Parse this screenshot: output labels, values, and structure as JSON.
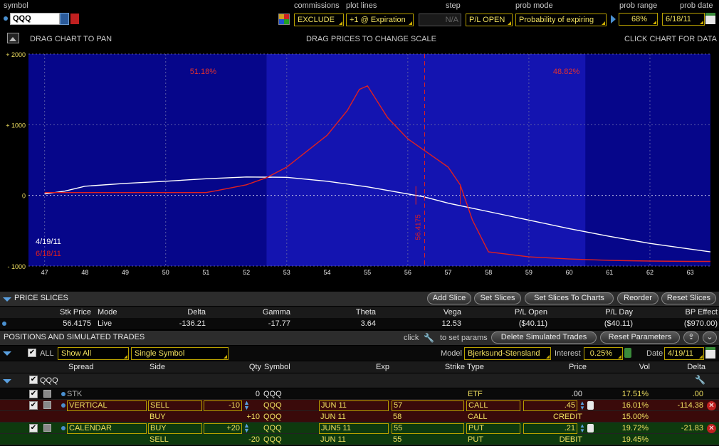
{
  "header": {
    "symbol_label": "symbol",
    "symbol_value": "QQQ",
    "commissions_label": "commissions",
    "commissions_value": "EXCLUDE",
    "plot_lines_label": "plot lines",
    "plot_lines_value": "+1 @ Expiration",
    "step_label": "step",
    "step_value": "N/A",
    "step_mode": "P/L OPEN",
    "prob_mode_label": "prob mode",
    "prob_mode_value": "Probability of expiring",
    "prob_range_label": "prob range",
    "prob_range_value": "68%",
    "prob_date_label": "prob date",
    "prob_date_value": "6/18/11"
  },
  "chart_hints": {
    "pan": "DRAG CHART TO PAN",
    "scale": "DRAG PRICES TO CHANGE SCALE",
    "click": "CLICK CHART FOR DATA"
  },
  "chart_data": {
    "type": "line",
    "x_ticks": [
      "47",
      "48",
      "49",
      "50",
      "51",
      "52",
      "53",
      "54",
      "55",
      "56",
      "57",
      "58",
      "59",
      "60",
      "61",
      "62",
      "63"
    ],
    "y_ticks": [
      "+ 2000",
      "+ 1000",
      "0",
      "- 1000"
    ],
    "xlim": [
      46.6,
      63.5
    ],
    "ylim": [
      -1000,
      2000
    ],
    "prob_left": "51.18%",
    "prob_right": "48.82%",
    "prob_range_x": [
      52.5,
      60.4
    ],
    "current_price_label": "56.4175",
    "current_price": 56.4175,
    "legend": [
      {
        "label": "4/19/11",
        "color": "#ffffff"
      },
      {
        "label": "6/18/11",
        "color": "#e02020"
      }
    ],
    "series": [
      {
        "name": "4/19/11",
        "color": "#ffffff",
        "x": [
          47,
          47.5,
          48,
          49,
          50,
          51,
          52,
          53,
          54,
          55,
          56,
          56.4,
          57,
          57.5,
          58,
          59,
          60,
          61,
          62,
          63,
          63.5
        ],
        "y": [
          20,
          60,
          130,
          170,
          200,
          235,
          260,
          255,
          200,
          120,
          20,
          -20,
          -110,
          -170,
          -230,
          -350,
          -470,
          -580,
          -680,
          -760,
          -800
        ]
      },
      {
        "name": "6/18/11",
        "color": "#e02020",
        "x": [
          47,
          48,
          50,
          51,
          51.2,
          52,
          52.5,
          53,
          54,
          54.5,
          54.8,
          55,
          55.5,
          56,
          56.5,
          57,
          57.3,
          57.6,
          58,
          59,
          60,
          61,
          62,
          63,
          63.5
        ],
        "y": [
          40,
          40,
          40,
          40,
          60,
          150,
          250,
          400,
          850,
          1200,
          1500,
          1550,
          1100,
          800,
          600,
          400,
          150,
          -350,
          -800,
          -870,
          -900,
          -920,
          -930,
          -935,
          -935
        ]
      }
    ]
  },
  "price_slices": {
    "title": "PRICE SLICES",
    "buttons": [
      "Add Slice",
      "Set Slices",
      "Set Slices To Charts",
      "Reorder",
      "Reset Slices"
    ],
    "headers": [
      "Stk Price",
      "Mode",
      "Delta",
      "Gamma",
      "Theta",
      "Vega",
      "P/L Open",
      "P/L Day",
      "BP Effect"
    ],
    "row": [
      "56.4175",
      "Live",
      "-136.21",
      "-17.77",
      "3.64",
      "12.53",
      "($40.11)",
      "($40.11)",
      "($970.00)"
    ]
  },
  "positions": {
    "title": "POSITIONS AND SIMULATED TRADES",
    "click_label": "click",
    "set_params_label": "to set params",
    "delete_btn": "Delete Simulated Trades",
    "reset_btn": "Reset Parameters",
    "all_label": "ALL",
    "show_value": "Show All",
    "symbol_mode": "Single Symbol",
    "model_label": "Model",
    "model_value": "Bjerksund-Stensland",
    "interest_label": "Interest",
    "interest_value": "0.25%",
    "date_label": "Date",
    "date_value": "4/19/11",
    "columns": [
      "Spread",
      "Side",
      "Qty",
      "Symbol",
      "Exp",
      "Strike",
      "Type",
      "Price",
      "Vol",
      "Delta"
    ],
    "group": "QQQ",
    "rows": [
      {
        "spread": "STK",
        "side": "",
        "qty": "0",
        "symbol": "QQQ",
        "exp": "",
        "strike": "",
        "type": "ETF",
        "price": ".00",
        "vol": "17.51%",
        "delta": ".00"
      },
      {
        "spread": "VERTICAL",
        "side": "SELL",
        "qty": "-10",
        "symbol": "QQQ",
        "exp": "JUN 11",
        "strike": "57",
        "type": "CALL",
        "price": ".45",
        "vol": "16.01%",
        "delta": "-114.38"
      },
      {
        "spread": "",
        "side": "BUY",
        "qty": "+10",
        "symbol": "QQQ",
        "exp": "JUN 11",
        "strike": "58",
        "type": "CALL",
        "price": "CREDIT",
        "vol": "15.00%",
        "delta": ""
      },
      {
        "spread": "CALENDAR",
        "side": "BUY",
        "qty": "+20",
        "symbol": "QQQ",
        "exp": "JUN5 11",
        "strike": "55",
        "type": "PUT",
        "price": ".21",
        "vol": "19.72%",
        "delta": "-21.83"
      },
      {
        "spread": "",
        "side": "SELL",
        "qty": "-20",
        "symbol": "QQQ",
        "exp": "JUN 11",
        "strike": "55",
        "type": "PUT",
        "price": "DEBIT",
        "vol": "19.45%",
        "delta": ""
      }
    ]
  }
}
